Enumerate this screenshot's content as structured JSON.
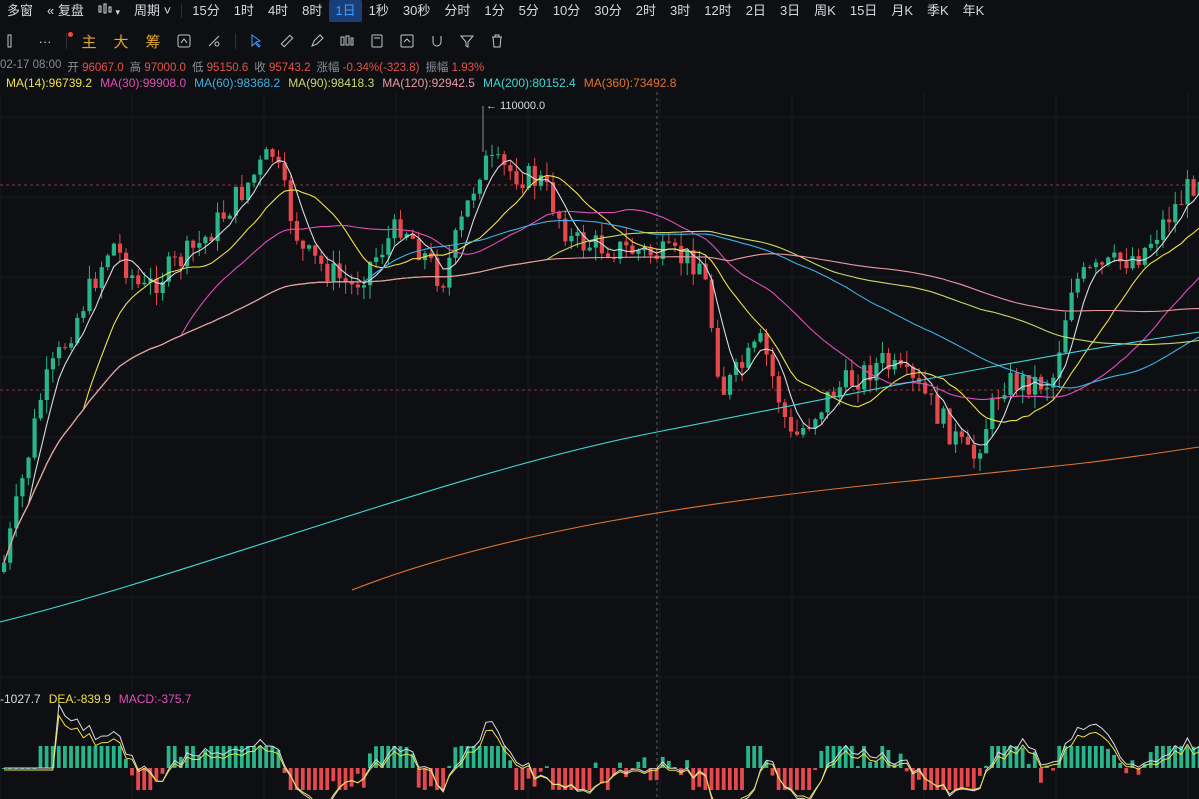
{
  "topbar": {
    "items": [
      "多窗",
      "复盘",
      "周期",
      "15分",
      "1时",
      "4时",
      "8时",
      "1日",
      "1秒",
      "30秒",
      "分时",
      "1分",
      "5分",
      "10分",
      "30分",
      "2时",
      "3时",
      "12时",
      "2日",
      "3日",
      "周K",
      "15日",
      "月K",
      "季K",
      "年K"
    ],
    "active": "1日"
  },
  "toolbar": {
    "more": "···",
    "main": "主",
    "big": "大",
    "chips": "筹"
  },
  "ohlc": {
    "date": "02-17 08:00",
    "open_label": "开",
    "open": "96067.0",
    "high_label": "高",
    "high": "97000.0",
    "low_label": "低",
    "low": "95150.6",
    "close_label": "收",
    "close": "95743.2",
    "change_label": "涨幅",
    "change": "-0.34%(-323.8)",
    "amp_label": "振幅",
    "amp": "1.93%"
  },
  "ma_legend": [
    {
      "text": "MA(14):96739.2",
      "color": "#f0e04a"
    },
    {
      "text": "MA(30):99908.0",
      "color": "#e04fb8"
    },
    {
      "text": "MA(60):98368.2",
      "color": "#3fb1e6"
    },
    {
      "text": "MA(90):98418.3",
      "color": "#c9d86a"
    },
    {
      "text": "MA(120):92942.5",
      "color": "#e89aa0"
    },
    {
      "text": "MA(200):80152.4",
      "color": "#3fd6d6"
    },
    {
      "text": "MA(360):73492.8",
      "color": "#e0742f"
    }
  ],
  "annotations": {
    "high_marker": "110000.0"
  },
  "macd_legend": {
    "dif": "-1027.7",
    "dea": "DEA:-839.9",
    "macd": "MACD:-375.7"
  },
  "colors": {
    "up": "#29b58a",
    "down": "#e5484d",
    "ma14": "#f0e04a",
    "ma30": "#e04fb8",
    "ma60": "#3fb1e6",
    "ma90": "#c9d86a",
    "ma120": "#e89aa0",
    "ma200": "#3fd6d6",
    "ma360": "#e0742f",
    "kline_white": "#d9dbe0"
  }
}
